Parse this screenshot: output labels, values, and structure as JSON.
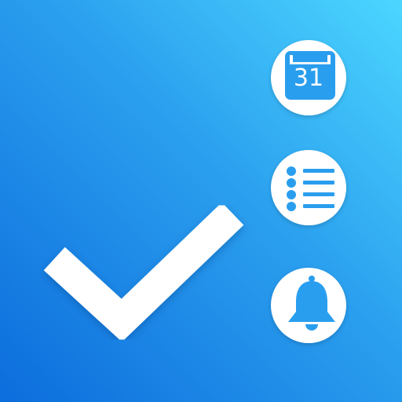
{
  "icon": {
    "calendar_day": "31",
    "colors": {
      "background_start": "#4cd6ff",
      "background_end": "#0c6ddc",
      "glyph": "#2a9eee",
      "badge": "#ffffff",
      "checkmark": "#ffffff"
    },
    "glyphs": [
      "checkmark-icon",
      "calendar-icon",
      "list-icon",
      "bell-icon"
    ]
  }
}
